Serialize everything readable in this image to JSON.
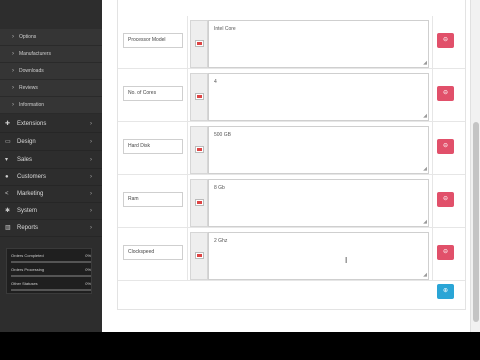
{
  "sidebar": {
    "sub_items": [
      {
        "label": "Options"
      },
      {
        "label": "Manufacturers"
      },
      {
        "label": "Downloads"
      },
      {
        "label": "Reviews"
      },
      {
        "label": "Information"
      }
    ],
    "menu_items": [
      {
        "label": "Extensions",
        "icon": "puzzle-icon"
      },
      {
        "label": "Design",
        "icon": "monitor-icon"
      },
      {
        "label": "Sales",
        "icon": "cart-icon"
      },
      {
        "label": "Customers",
        "icon": "user-icon"
      },
      {
        "label": "Marketing",
        "icon": "share-icon"
      },
      {
        "label": "System",
        "icon": "gear-icon"
      },
      {
        "label": "Reports",
        "icon": "bar-chart-icon"
      }
    ],
    "stats": [
      {
        "label": "Orders Completed",
        "value": "0%"
      },
      {
        "label": "Orders Processing",
        "value": "0%"
      },
      {
        "label": "Other Statuses",
        "value": "0%"
      }
    ]
  },
  "attributes": [
    {
      "name": "Processor Model",
      "value": "Intel Core"
    },
    {
      "name": "No. of Cores",
      "value": "4"
    },
    {
      "name": "Hard Disk",
      "value": "500 GB"
    },
    {
      "name": "Ram",
      "value": "8 Gb"
    },
    {
      "name": "Clockspeed",
      "value": "2 Ghz"
    }
  ],
  "icons": {
    "delete": "minus-circle-icon",
    "add": "plus-circle-icon",
    "flag": "uk-flag-icon"
  },
  "colors": {
    "sidebar_bg": "#2d2d2d",
    "delete_button": "#e1506a",
    "add_button": "#2aa5d6"
  }
}
